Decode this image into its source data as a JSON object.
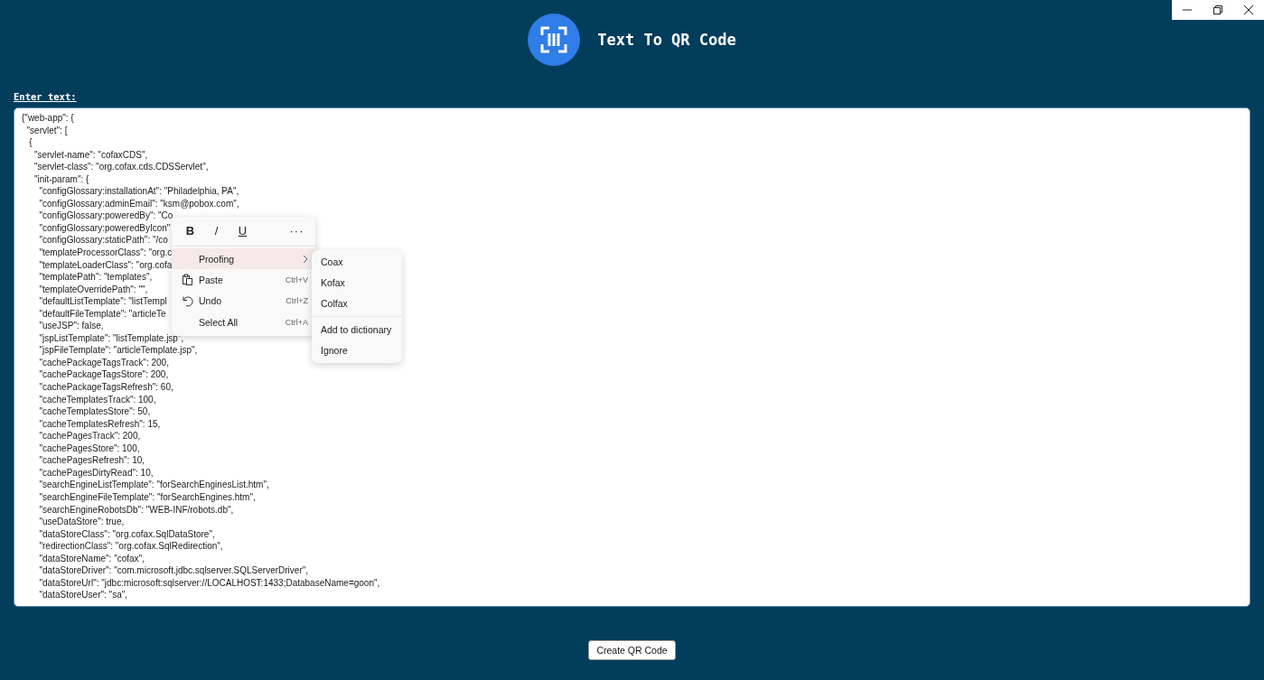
{
  "header": {
    "title": "Text To QR Code"
  },
  "input": {
    "label": "Enter text:",
    "lines": [
      "{\"web-app\": {",
      "  \"servlet\": [",
      "   {",
      "     \"servlet-name\": \"cofaxCDS\",",
      "     \"servlet-class\": \"org.cofax.cds.CDSServlet\",",
      "     \"init-param\": {",
      "       \"configGlossary:installationAt\": \"Philadelphia, PA\",",
      "       \"configGlossary:adminEmail\": \"ksm@pobox.com\",",
      "       \"configGlossary:poweredBy\": \"Co",
      "       \"configGlossary:poweredByIcon\"",
      "       \"configGlossary:staticPath\": \"/co",
      "       \"templateProcessorClass\": \"org.c",
      "       \"templateLoaderClass\": \"org.cofa",
      "       \"templatePath\": \"templates\",",
      "       \"templateOverridePath\": \"\",",
      "       \"defaultListTemplate\": \"listTempl",
      "       \"defaultFileTemplate\": \"articleTe",
      "       \"useJSP\": false,",
      "       \"jspListTemplate\": \"listTemplate.jsp\",",
      "       \"jspFileTemplate\": \"articleTemplate.jsp\",",
      "       \"cachePackageTagsTrack\": 200,",
      "       \"cachePackageTagsStore\": 200,",
      "       \"cachePackageTagsRefresh\": 60,",
      "       \"cacheTemplatesTrack\": 100,",
      "       \"cacheTemplatesStore\": 50,",
      "       \"cacheTemplatesRefresh\": 15,",
      "       \"cachePagesTrack\": 200,",
      "       \"cachePagesStore\": 100,",
      "       \"cachePagesRefresh\": 10,",
      "       \"cachePagesDirtyRead\": 10,",
      "       \"searchEngineListTemplate\": \"forSearchEnginesList.htm\",",
      "       \"searchEngineFileTemplate\": \"forSearchEngines.htm\",",
      "       \"searchEngineRobotsDb\": \"WEB-INF/robots.db\",",
      "       \"useDataStore\": true,",
      "       \"dataStoreClass\": \"org.cofax.SqlDataStore\",",
      "       \"redirectionClass\": \"org.cofax.SqlRedirection\",",
      "       \"dataStoreName\": \"cofax\",",
      "       \"dataStoreDriver\": \"com.microsoft.jdbc.sqlserver.SQLServerDriver\",",
      "       \"dataStoreUrl\": \"jdbc:microsoft:sqlserver://LOCALHOST:1433;DatabaseName=goon\",",
      "       \"dataStoreUser\": \"sa\","
    ]
  },
  "context_menu": {
    "format_buttons": [
      {
        "kind": "bold",
        "label": "B"
      },
      {
        "kind": "italic",
        "label": "/"
      },
      {
        "kind": "underline",
        "label": "U"
      },
      {
        "kind": "more",
        "label": "···"
      }
    ],
    "items": [
      {
        "kind": "submenu",
        "label": "Proofing",
        "selected": true
      },
      {
        "kind": "paste",
        "label": "Paste",
        "shortcut": "Ctrl+V",
        "selected": false
      },
      {
        "kind": "undo",
        "label": "Undo",
        "shortcut": "Ctrl+Z",
        "selected": false
      },
      {
        "kind": "plain",
        "label": "Select All",
        "shortcut": "Ctrl+A",
        "selected": false
      }
    ],
    "submenu": {
      "suggestions": [
        "Coax",
        "Kofax",
        "Colfax"
      ],
      "actions": [
        "Add to dictionary",
        "Ignore"
      ]
    }
  },
  "button": {
    "label": "Create QR Code"
  }
}
